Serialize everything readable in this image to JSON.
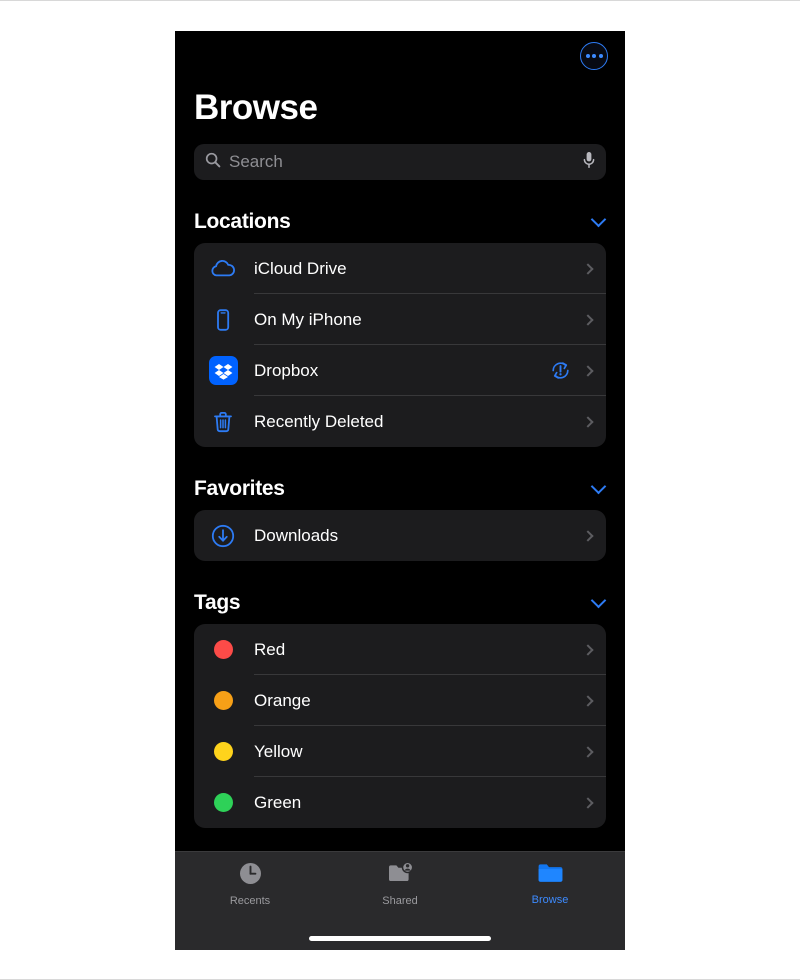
{
  "theme": {
    "screen_bg": "#000000",
    "group_bg": "#1c1c1e",
    "tabbar_bg": "#2a2a2c",
    "accent_blue": "#2d7bf4",
    "tab_active_blue": "#3d8bff",
    "label_white": "#ffffff",
    "secondary_gray": "#8e8e93",
    "chevron_gray": "#5c5c60",
    "separator": "#38383a"
  },
  "navbar": {
    "more_button": "more-options",
    "more_icon": "ellipsis-circle-icon"
  },
  "header": {
    "title": "Browse"
  },
  "search": {
    "placeholder": "Search",
    "value": "",
    "search_icon": "magnifier-icon",
    "dictation_icon": "microphone-icon"
  },
  "sections": [
    {
      "id": "locations",
      "title": "Locations",
      "collapse_icon": "chevron-down-icon",
      "expanded": true,
      "rows": [
        {
          "label": "iCloud Drive",
          "icon": "icloud-drive-icon",
          "icon_color": "#2d7bf4",
          "badge": null,
          "chevron": "chevron-right-icon"
        },
        {
          "label": "On My iPhone",
          "icon": "iphone-icon",
          "icon_color": "#2d7bf4",
          "badge": null,
          "chevron": "chevron-right-icon"
        },
        {
          "label": "Dropbox",
          "icon": "dropbox-icon",
          "icon_color": "#0062ff",
          "badge": "sync-error-icon",
          "chevron": "chevron-right-icon"
        },
        {
          "label": "Recently Deleted",
          "icon": "trash-icon",
          "icon_color": "#2d7bf4",
          "badge": null,
          "chevron": "chevron-right-icon"
        }
      ]
    },
    {
      "id": "favorites",
      "title": "Favorites",
      "collapse_icon": "chevron-down-icon",
      "expanded": true,
      "rows": [
        {
          "label": "Downloads",
          "icon": "download-circle-icon",
          "icon_color": "#2d7bf4",
          "badge": null,
          "chevron": "chevron-right-icon"
        }
      ]
    },
    {
      "id": "tags",
      "title": "Tags",
      "collapse_icon": "chevron-down-icon",
      "expanded": true,
      "rows": [
        {
          "label": "Red",
          "icon": "tag-color-dot",
          "icon_color": "#fc4b48",
          "badge": null,
          "chevron": "chevron-right-icon"
        },
        {
          "label": "Orange",
          "icon": "tag-color-dot",
          "icon_color": "#f7a017",
          "badge": null,
          "chevron": "chevron-right-icon"
        },
        {
          "label": "Yellow",
          "icon": "tag-color-dot",
          "icon_color": "#fed31c",
          "badge": null,
          "chevron": "chevron-right-icon"
        },
        {
          "label": "Green",
          "icon": "tag-color-dot",
          "icon_color": "#2ed158",
          "badge": null,
          "chevron": "chevron-right-icon"
        }
      ]
    }
  ],
  "tabbar": {
    "items": [
      {
        "label": "Recents",
        "icon": "clock-icon",
        "active": false
      },
      {
        "label": "Shared",
        "icon": "shared-folder-icon",
        "active": false
      },
      {
        "label": "Browse",
        "icon": "folder-icon",
        "active": true
      }
    ]
  }
}
